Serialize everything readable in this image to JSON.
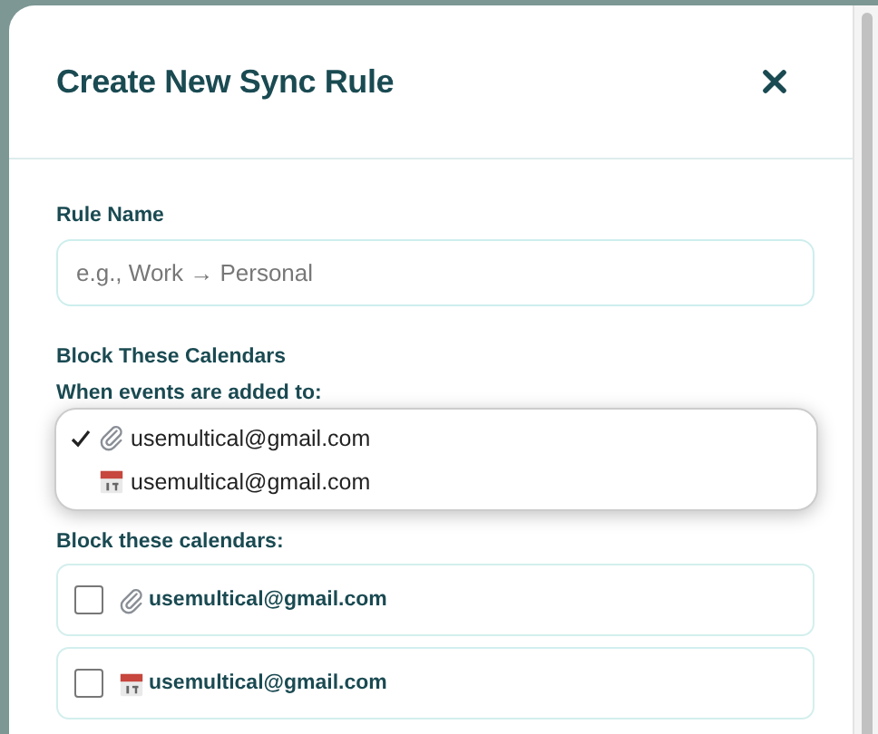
{
  "dialog": {
    "title": "Create New Sync Rule"
  },
  "rule_name": {
    "label": "Rule Name",
    "placeholder": "e.g., Work → Personal"
  },
  "section_title": "Block These Calendars",
  "source": {
    "label": "When events are added to:",
    "options": [
      {
        "label": "usemultical@gmail.com",
        "kind": "paperclip",
        "selected": true
      },
      {
        "label": "usemultical@gmail.com",
        "kind": "calendar",
        "selected": false
      }
    ]
  },
  "target": {
    "label": "Block these calendars:",
    "calendars": [
      {
        "label": "usemultical@gmail.com",
        "kind": "paperclip",
        "checked": false
      },
      {
        "label": "usemultical@gmail.com",
        "kind": "calendar",
        "checked": false
      }
    ]
  }
}
